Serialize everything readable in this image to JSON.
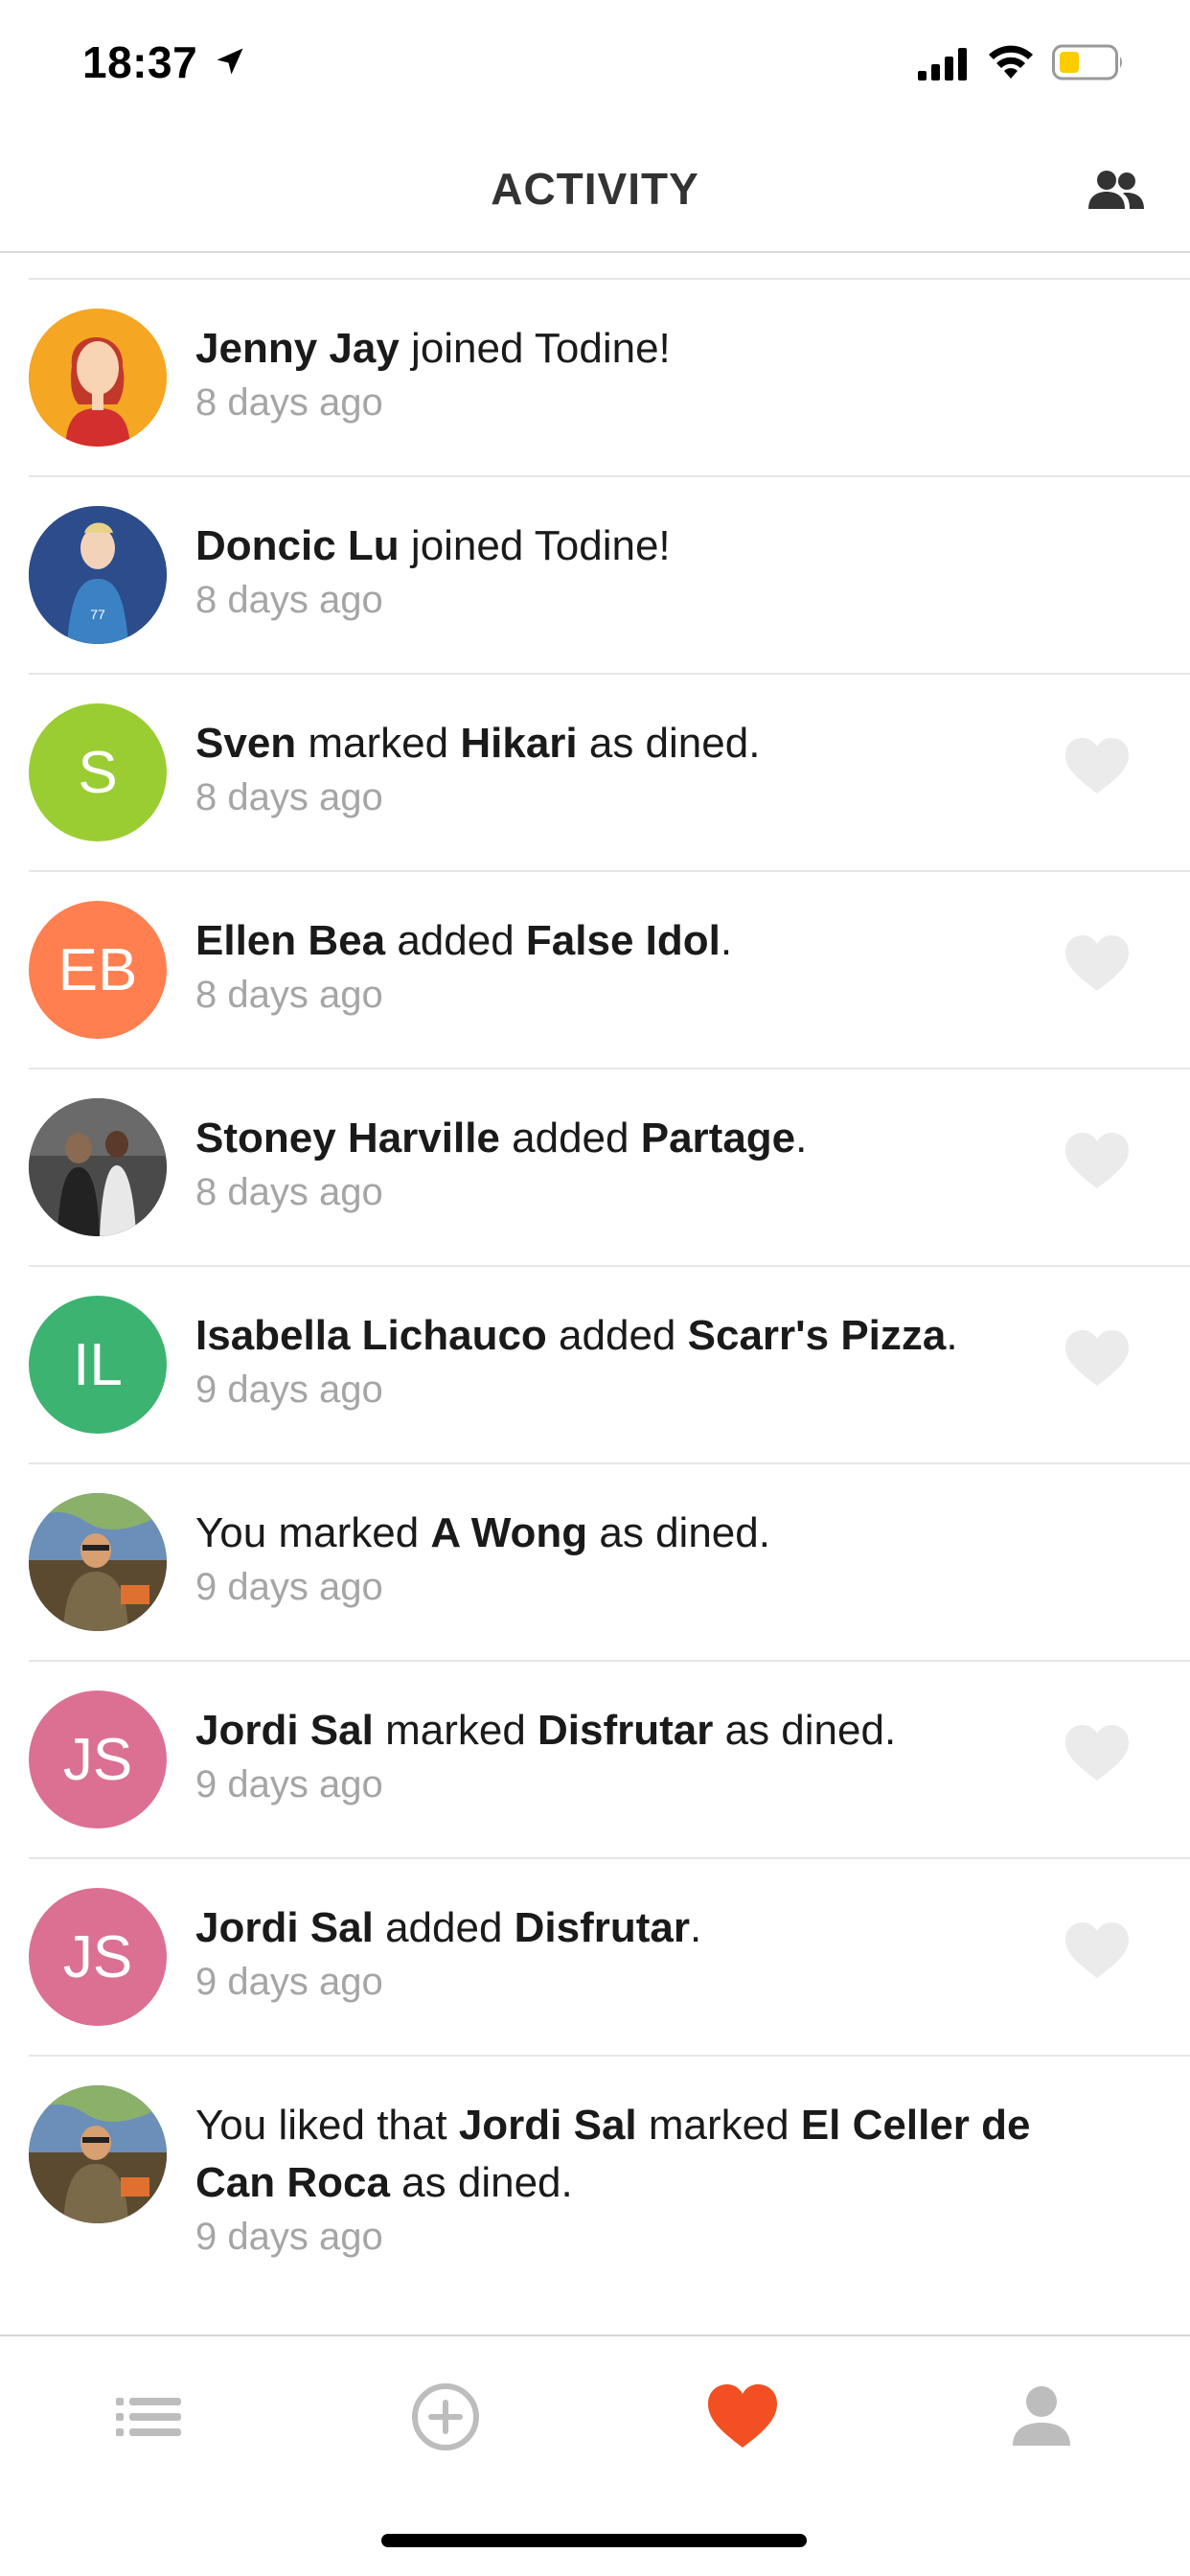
{
  "status_bar": {
    "time": "18:37"
  },
  "header": {
    "title": "ACTIVITY"
  },
  "feed": [
    {
      "avatar_type": "photo",
      "avatar_bg": "#F5A623",
      "segments": [
        {
          "t": "Jenny Jay",
          "b": true
        },
        {
          "t": " joined Todine!",
          "b": false
        }
      ],
      "time": "8 days ago",
      "likeable": false
    },
    {
      "avatar_type": "photo",
      "avatar_bg": "#2C4C8C",
      "segments": [
        {
          "t": "Doncic Lu",
          "b": true
        },
        {
          "t": " joined Todine!",
          "b": false
        }
      ],
      "time": "8 days ago",
      "likeable": false
    },
    {
      "avatar_type": "initials",
      "initials": "S",
      "avatar_bg": "#9ACD32",
      "segments": [
        {
          "t": "Sven",
          "b": true
        },
        {
          "t": " marked ",
          "b": false
        },
        {
          "t": "Hikari",
          "b": true
        },
        {
          "t": " as dined.",
          "b": false
        }
      ],
      "time": "8 days ago",
      "likeable": true
    },
    {
      "avatar_type": "initials",
      "initials": "EB",
      "avatar_bg": "#FF7F50",
      "segments": [
        {
          "t": "Ellen Bea",
          "b": true
        },
        {
          "t": " added ",
          "b": false
        },
        {
          "t": "False Idol",
          "b": true
        },
        {
          "t": ".",
          "b": false
        }
      ],
      "time": "8 days ago",
      "likeable": true
    },
    {
      "avatar_type": "photo",
      "avatar_bg": "#3A3A3A",
      "segments": [
        {
          "t": "Stoney Harville",
          "b": true
        },
        {
          "t": " added ",
          "b": false
        },
        {
          "t": "Partage",
          "b": true
        },
        {
          "t": ".",
          "b": false
        }
      ],
      "time": "8 days ago",
      "likeable": true
    },
    {
      "avatar_type": "initials",
      "initials": "IL",
      "avatar_bg": "#3CB371",
      "segments": [
        {
          "t": "Isabella Lichauco",
          "b": true
        },
        {
          "t": " added ",
          "b": false
        },
        {
          "t": "Scarr's Pizza",
          "b": true
        },
        {
          "t": ".",
          "b": false
        }
      ],
      "time": "9 days ago",
      "likeable": true
    },
    {
      "avatar_type": "photo",
      "avatar_bg": "#6B5A3A",
      "segments": [
        {
          "t": "You marked ",
          "b": false
        },
        {
          "t": "A Wong",
          "b": true
        },
        {
          "t": " as dined.",
          "b": false
        }
      ],
      "time": "9 days ago",
      "likeable": false
    },
    {
      "avatar_type": "initials",
      "initials": "JS",
      "avatar_bg": "#DB7093",
      "segments": [
        {
          "t": "Jordi Sal",
          "b": true
        },
        {
          "t": " marked ",
          "b": false
        },
        {
          "t": "Disfrutar",
          "b": true
        },
        {
          "t": " as dined.",
          "b": false
        }
      ],
      "time": "9 days ago",
      "likeable": true
    },
    {
      "avatar_type": "initials",
      "initials": "JS",
      "avatar_bg": "#DB7093",
      "segments": [
        {
          "t": "Jordi Sal",
          "b": true
        },
        {
          "t": " added ",
          "b": false
        },
        {
          "t": "Disfrutar",
          "b": true
        },
        {
          "t": ".",
          "b": false
        }
      ],
      "time": "9 days ago",
      "likeable": true
    },
    {
      "avatar_type": "photo",
      "avatar_bg": "#6B5A3A",
      "segments": [
        {
          "t": "You liked that ",
          "b": false
        },
        {
          "t": "Jordi Sal",
          "b": true
        },
        {
          "t": " marked ",
          "b": false
        },
        {
          "t": "El Celler de Can Roca",
          "b": true
        },
        {
          "t": " as dined.",
          "b": false
        }
      ],
      "time": "9 days ago",
      "likeable": false
    }
  ],
  "tab_bar": {
    "tabs": [
      {
        "name": "list-icon",
        "active": false
      },
      {
        "name": "add-circle-icon",
        "active": false
      },
      {
        "name": "heart-icon",
        "active": true
      },
      {
        "name": "profile-icon",
        "active": false
      }
    ]
  },
  "colors": {
    "accent": "#F25022",
    "inactive_icon": "#BDBDBD",
    "like_heart": "#EBEBEB",
    "secondary_text": "#A5A5A5"
  }
}
